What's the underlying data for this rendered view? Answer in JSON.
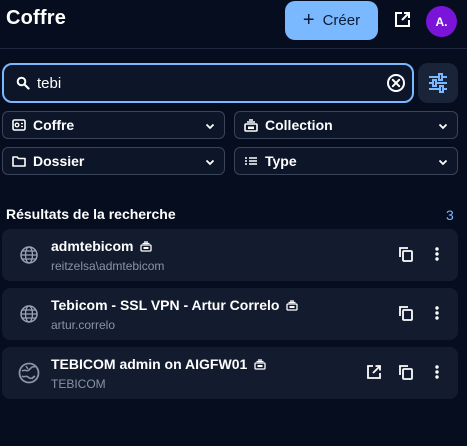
{
  "header": {
    "title": "Coffre",
    "create_label": "Créer",
    "avatar_initials": "A."
  },
  "search": {
    "value": "tebi"
  },
  "filters": [
    {
      "label": "Coffre",
      "icon": "vault-icon"
    },
    {
      "label": "Collection",
      "icon": "collection-icon"
    },
    {
      "label": "Dossier",
      "icon": "folder-icon"
    },
    {
      "label": "Type",
      "icon": "list-icon"
    }
  ],
  "results": {
    "heading": "Résultats de la recherche",
    "count": "3",
    "items": [
      {
        "name": "admtebicom",
        "subtitle": "reitzelsa\\admtebicom",
        "icon": "globe-icon"
      },
      {
        "name": "Tebicom - SSL VPN - Artur Correlo",
        "subtitle": "artur.correlo",
        "icon": "globe-icon"
      },
      {
        "name": "TEBICOM admin on AIGFW01",
        "subtitle": "TEBICOM",
        "icon": "site-favicon-icon"
      }
    ]
  },
  "colors": {
    "accent": "#7ab8ff",
    "background": "#060d1f",
    "card": "#131b2e",
    "avatar": "#7a14d9"
  }
}
